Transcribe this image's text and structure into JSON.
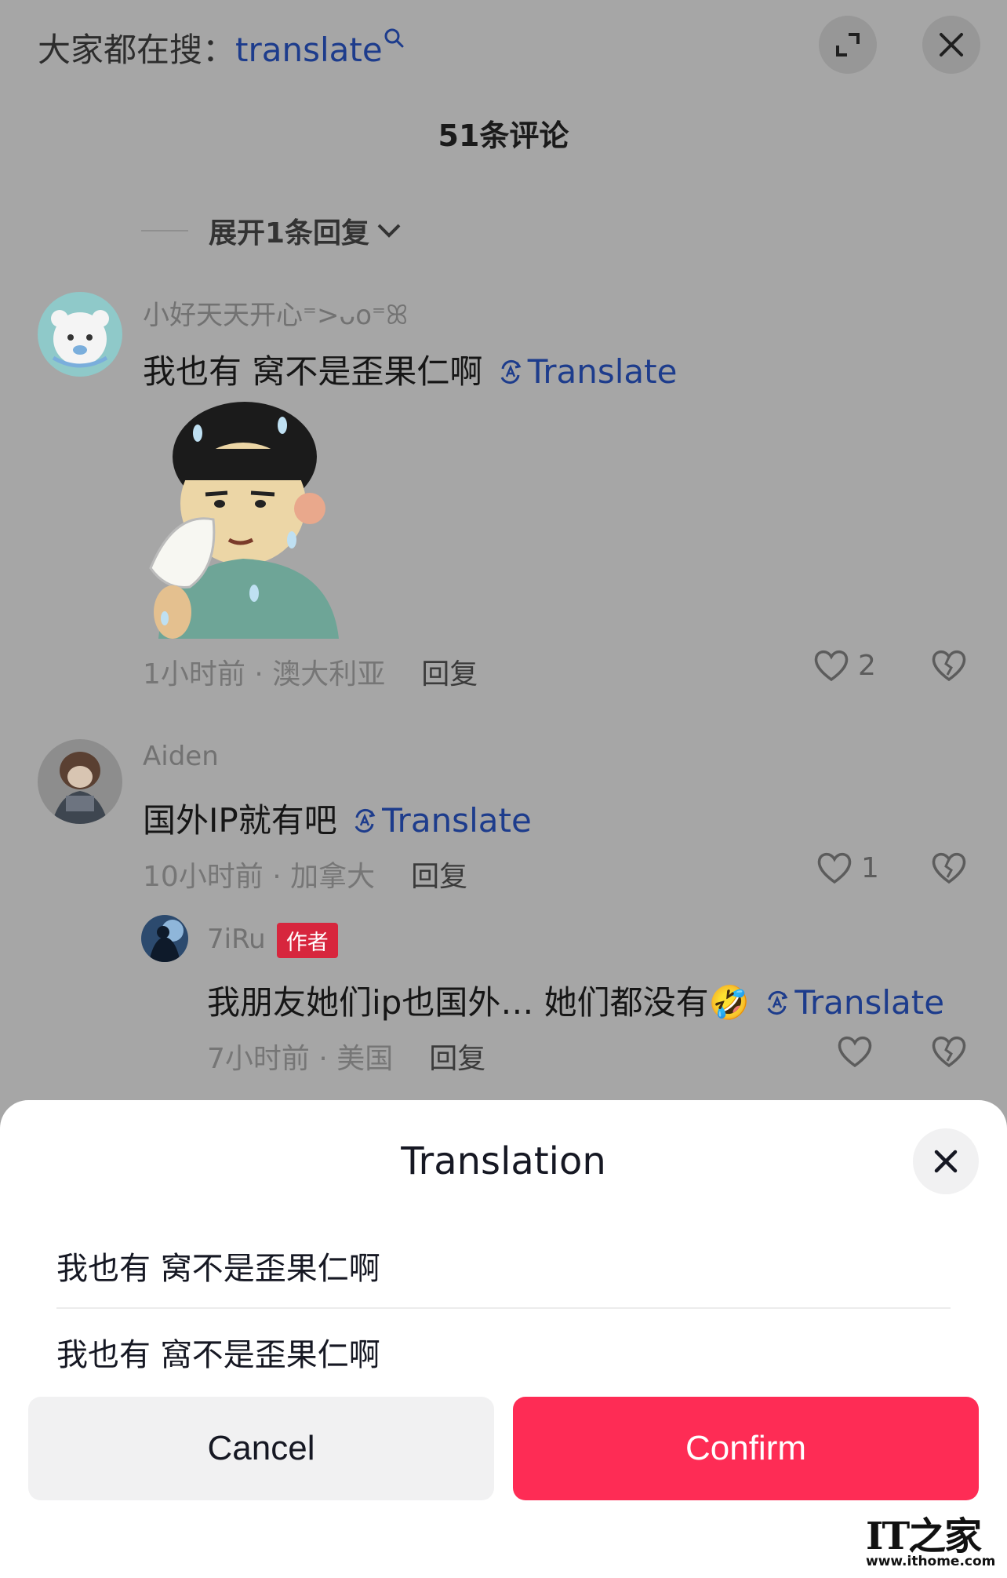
{
  "search": {
    "prefix": "大家都在搜：",
    "term": "translate"
  },
  "icons": {
    "search": "search-icon",
    "expand": "expand-icon",
    "close": "close-icon",
    "translate": "translate-icon",
    "heart": "heart-icon",
    "dislike": "broken-heart-icon",
    "chevron": "chevron-down-icon"
  },
  "header": {
    "comment_count": "51条评论",
    "expand_replies": "展开1条回复"
  },
  "comments": [
    {
      "username": "小好天天开心⁼>ᴗo⁼ꕤ",
      "text": "我也有 窝不是歪果仁啊",
      "translate": "Translate",
      "time_location": "1小时前 · 澳大利亚",
      "reply": "回复",
      "likes": "2"
    },
    {
      "username": "Aiden",
      "text": "国外IP就有吧",
      "translate": "Translate",
      "time_location": "10小时前 · 加拿大",
      "reply": "回复",
      "likes": "1"
    }
  ],
  "reply": {
    "username": "7iRu",
    "badge": "作者",
    "text": "我朋友她们ip也国外… 她们都没有",
    "emoji": "🤣",
    "translate": "Translate",
    "time_location": "7小时前 · 美国",
    "reply": "回复"
  },
  "sheet": {
    "title": "Translation",
    "original": "我也有 窝不是歪果仁啊",
    "translated": "我也有 窩不是歪果仁啊",
    "cancel": "Cancel",
    "confirm": "Confirm"
  },
  "watermark": {
    "logo": "IT之家",
    "url": "www.ithome.com"
  },
  "colors": {
    "accent_pink": "#fe2c55",
    "link_blue": "#1d3c8c",
    "badge_red": "#d7263d",
    "overlay_gray": "#a6a6a6"
  }
}
